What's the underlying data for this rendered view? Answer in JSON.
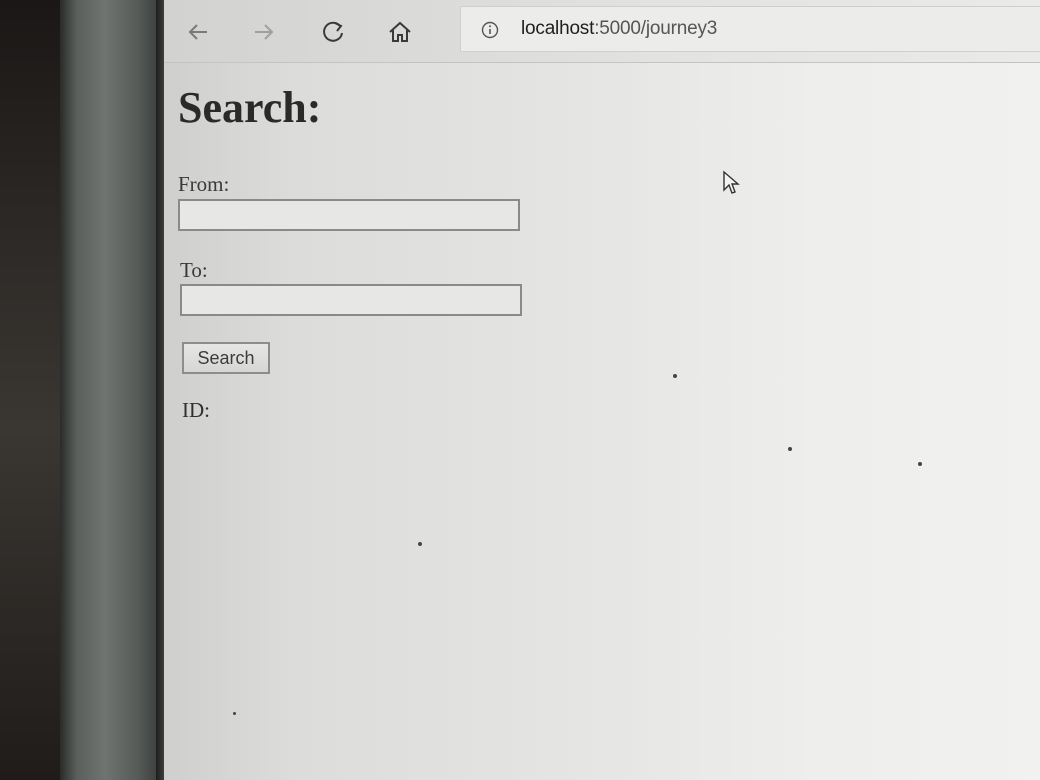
{
  "browser": {
    "url_host": "localhost",
    "url_path": ":5000/journey3",
    "icons": [
      "back-arrow-icon",
      "forward-arrow-icon",
      "refresh-icon",
      "home-icon",
      "info-icon"
    ]
  },
  "page": {
    "heading": "Search:",
    "from_label": "From:",
    "from_value": "",
    "to_label": "To:",
    "to_value": "",
    "search_button": "Search",
    "id_label": "ID:"
  },
  "colors": {
    "page_background": "#e4e4e2",
    "toolbar": "#dcdcda",
    "text": "#2a2a2a"
  }
}
